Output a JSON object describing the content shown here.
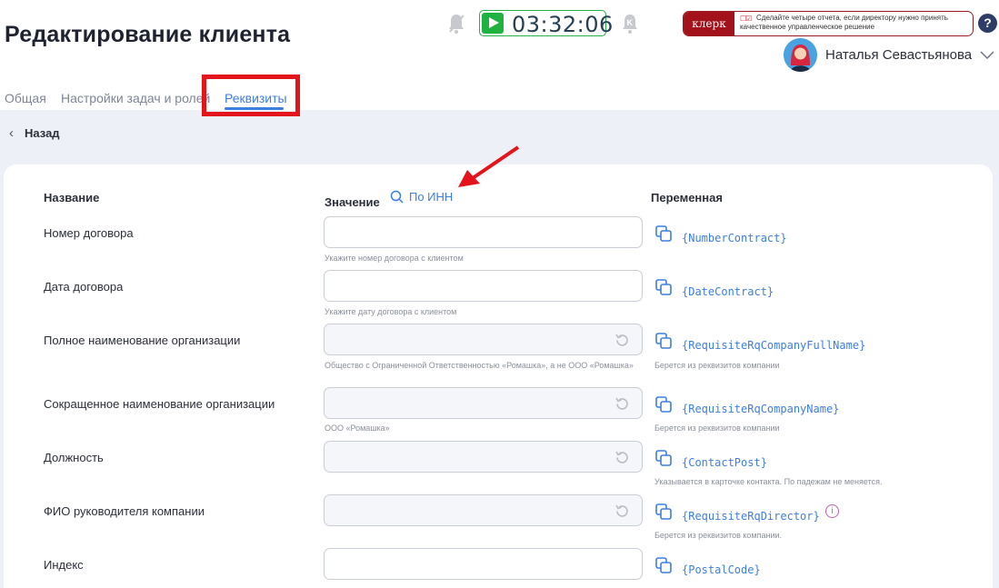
{
  "header": {
    "title": "Редактирование клиента",
    "timer": "03:32:06",
    "banner_logo": "клерк",
    "banner_text": "Сделайте четыре отчета, если директору нужно принять качественное управленческое решение",
    "help": "?",
    "user_name": "Наталья Севастьянова"
  },
  "tabs": [
    {
      "label": "Общая"
    },
    {
      "label": "Настройки задач и ролей"
    },
    {
      "label": "Реквизиты",
      "active": true
    }
  ],
  "back_label": "Назад",
  "table": {
    "col_name": "Название",
    "col_value": "Значение",
    "inn_link": "По ИНН",
    "col_variable": "Переменная"
  },
  "rows": [
    {
      "label": "Номер договора",
      "value": "",
      "hint": "Укажите номер договора с клиентом",
      "variable": "{NumberContract}",
      "var_hint": ""
    },
    {
      "label": "Дата договора",
      "value": "",
      "hint": "Укажите дату договора с клиентом",
      "variable": "{DateContract}",
      "var_hint": ""
    },
    {
      "label": "Полное наименование организации",
      "value": "",
      "hint": "Общество с Ограниченной Ответственностью «Ромашка», а не ООО «Ромашка»",
      "variable": "{RequisiteRqCompanyFullName}",
      "var_hint": "Берется из реквизитов компании"
    },
    {
      "label": "Сокращенное наименование организации",
      "value": "",
      "hint": "ООО «Ромашка»",
      "variable": "{RequisiteRqCompanyName}",
      "var_hint": "Берется из реквизитов компании"
    },
    {
      "label": "Должность",
      "value": "",
      "hint": "",
      "variable": "{ContactPost}",
      "var_hint": "Указывается в карточке контакта. По падежам не меняется."
    },
    {
      "label": "ФИО руководителя компании",
      "value": "",
      "hint": "",
      "variable": "{RequisiteRqDirector}",
      "var_hint": "Берется из реквизитов компании."
    },
    {
      "label": "Индекс",
      "value": "",
      "hint": "",
      "variable": "{PostalCode}",
      "var_hint": ""
    }
  ],
  "info_glyph": "i",
  "colors": {
    "accent": "#3d7fe0",
    "timer_green": "#1fb241",
    "annotation_red": "#e3141c"
  }
}
